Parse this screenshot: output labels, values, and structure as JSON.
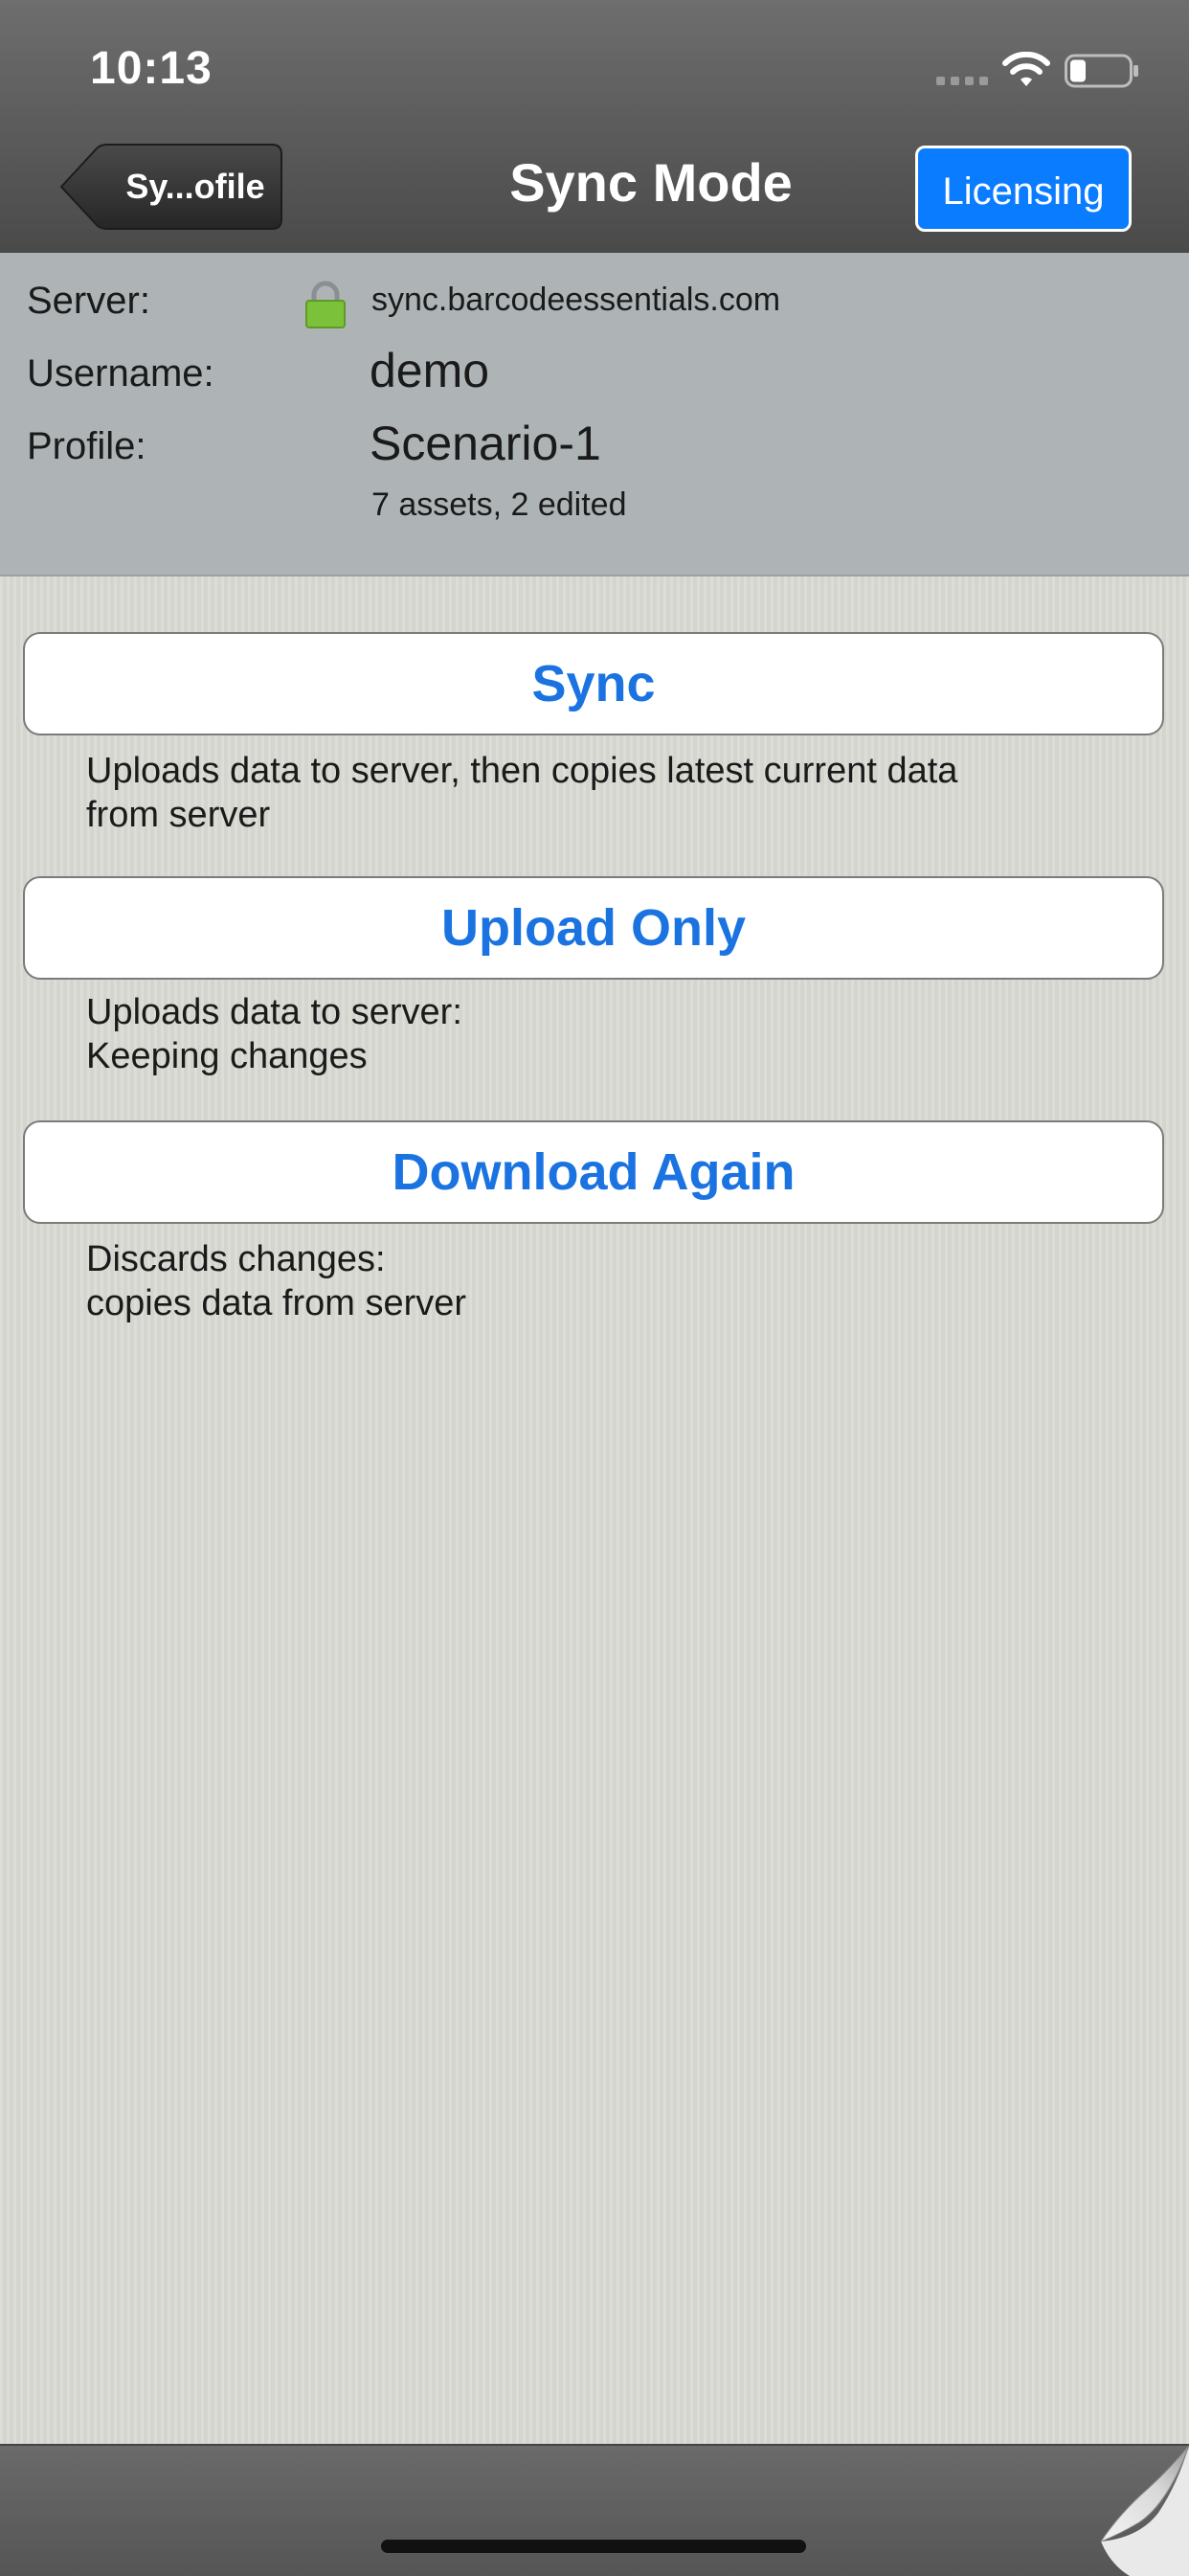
{
  "status_bar": {
    "time": "10:13"
  },
  "nav": {
    "back_label": "Sy...ofile",
    "title": "Sync Mode",
    "licensing_label": "Licensing"
  },
  "info": {
    "server_label": "Server:",
    "server_value": "sync.barcodeessentials.com",
    "username_label": "Username:",
    "username_value": "demo",
    "profile_label": "Profile:",
    "profile_value": "Scenario-1",
    "profile_detail": "7 assets, 2 edited"
  },
  "actions": {
    "sync": {
      "label": "Sync",
      "desc_line1": "Uploads data to server, then copies latest current data",
      "desc_line2": "from server"
    },
    "upload": {
      "label": "Upload Only",
      "desc_line1": "Uploads data to server:",
      "desc_line2": "Keeping changes"
    },
    "download": {
      "label": "Download Again",
      "desc_line1": "Discards changes:",
      "desc_line2": "copies data from server"
    }
  },
  "colors": {
    "accent_blue": "#0a7cff",
    "button_text_blue": "#1a73e0",
    "header_gray": "#5a5a5a",
    "info_panel_gray": "#aeb4b5",
    "lock_green": "#7cc13a"
  },
  "icons": {
    "wifi": "wifi-icon",
    "battery": "battery-icon",
    "signal": "cellular-signal-icon",
    "lock": "lock-icon",
    "page_curl": "page-curl-icon"
  }
}
